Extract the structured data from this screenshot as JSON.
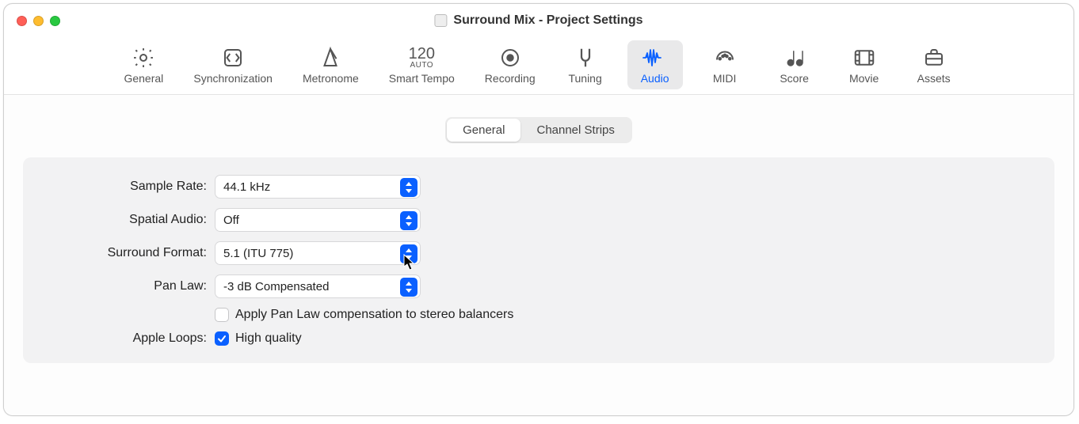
{
  "window": {
    "title": "Surround Mix - Project Settings"
  },
  "toolbar": {
    "items": [
      {
        "label": "General"
      },
      {
        "label": "Synchronization"
      },
      {
        "label": "Metronome"
      },
      {
        "label": "Smart Tempo",
        "big": "120",
        "small": "AUTO"
      },
      {
        "label": "Recording"
      },
      {
        "label": "Tuning"
      },
      {
        "label": "Audio"
      },
      {
        "label": "MIDI"
      },
      {
        "label": "Score"
      },
      {
        "label": "Movie"
      },
      {
        "label": "Assets"
      }
    ],
    "selected": "Audio"
  },
  "tabs": {
    "general": "General",
    "channel_strips": "Channel Strips",
    "active": "General"
  },
  "form": {
    "sample_rate_label": "Sample Rate:",
    "sample_rate_value": "44.1 kHz",
    "spatial_audio_label": "Spatial Audio:",
    "spatial_audio_value": "Off",
    "surround_format_label": "Surround Format:",
    "surround_format_value": "5.1 (ITU 775)",
    "pan_law_label": "Pan Law:",
    "pan_law_value": "-3 dB Compensated",
    "apply_pan_law_label": "Apply Pan Law compensation to stereo balancers",
    "apply_pan_law_checked": false,
    "apple_loops_label": "Apple Loops:",
    "high_quality_label": "High quality",
    "high_quality_checked": true
  }
}
